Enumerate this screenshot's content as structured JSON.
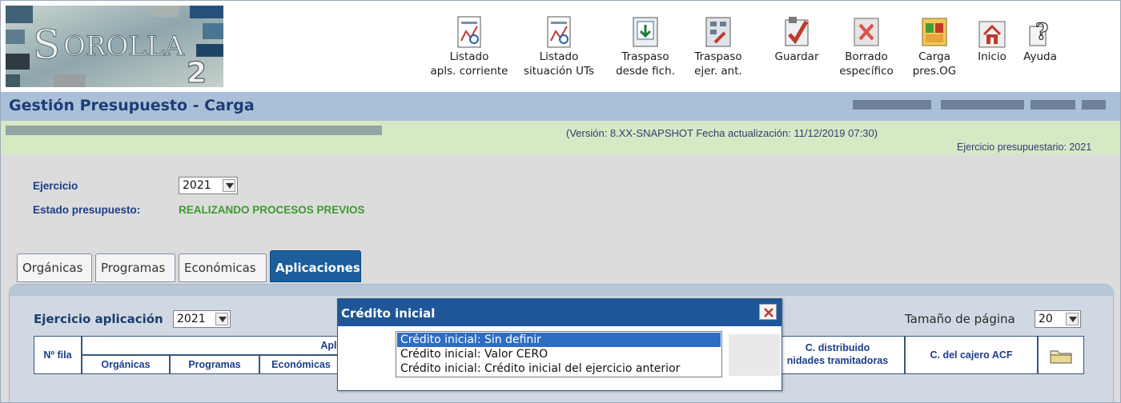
{
  "app": {
    "logo_text": "SOROLLA",
    "logo_sub": "2"
  },
  "toolbar": [
    {
      "id": "listado-apls",
      "line1": "Listado",
      "line2": "apls. corriente",
      "icon": "report-icon"
    },
    {
      "id": "listado-situacion",
      "line1": "Listado",
      "line2": "situación UTs",
      "icon": "report-icon"
    },
    {
      "id": "traspaso-fich",
      "line1": "Traspaso",
      "line2": "desde fich.",
      "icon": "import-icon"
    },
    {
      "id": "traspaso-ejer",
      "line1": "Traspaso",
      "line2": "ejer. ant.",
      "icon": "transfer-icon"
    },
    {
      "id": "guardar",
      "line1": "Guardar",
      "line2": "",
      "icon": "save-check-icon"
    },
    {
      "id": "borrado",
      "line1": "Borrado",
      "line2": "específico",
      "icon": "delete-icon"
    },
    {
      "id": "carga-pres",
      "line1": "Carga",
      "line2": "pres.OG",
      "icon": "load-icon"
    },
    {
      "id": "inicio",
      "line1": "Inicio",
      "line2": "",
      "icon": "home-icon"
    },
    {
      "id": "ayuda",
      "line1": "Ayuda",
      "line2": "",
      "icon": "help-icon"
    }
  ],
  "title": "Gestión Presupuesto - Carga",
  "info": {
    "version": "(Versión: 8.XX-SNAPSHOT Fecha actualización: 11/12/2019 07:30)",
    "ejercicio_presupuestario": "Ejercicio presupuestario: 2021"
  },
  "form": {
    "ejercicio_label": "Ejercicio",
    "ejercicio_value": "2021",
    "estado_label": "Estado presupuesto:",
    "estado_value": "REALIZANDO PROCESOS PREVIOS"
  },
  "tabs": [
    {
      "label": "Orgánicas",
      "active": false
    },
    {
      "label": "Programas",
      "active": false
    },
    {
      "label": "Económicas",
      "active": false
    },
    {
      "label": "Aplicaciones",
      "active": true
    }
  ],
  "panel": {
    "ejercicio_aplicacion_label": "Ejercicio aplicación",
    "ejercicio_aplicacion_value": "2021",
    "page_size_label": "Tamaño de página",
    "page_size_value": "20"
  },
  "table": {
    "nfila": "Nº fila",
    "aplicacion": "Aplicación",
    "organicas": "Orgánicas",
    "programas": "Programas",
    "economicas": "Económicas",
    "c_distribuido_1": "C. distribuido",
    "c_distribuido_2": "nidades tramitadoras",
    "cajero": "C. del cajero ACF"
  },
  "modal": {
    "title": "Crédito inicial",
    "options": [
      {
        "label": "Crédito inicial: Sin definir",
        "selected": true
      },
      {
        "label": "Crédito inicial: Valor CERO",
        "selected": false
      },
      {
        "label": "Crédito inicial: Crédito inicial del ejercicio anterior",
        "selected": false
      }
    ]
  },
  "colors": {
    "title_bar": "#a9c0d8",
    "info_bar": "#d7e8c5",
    "tab_active": "#1c5d9c",
    "modal_header": "#1f5697",
    "selection": "#2f6dc2",
    "estado_green": "#3c9a2e"
  }
}
